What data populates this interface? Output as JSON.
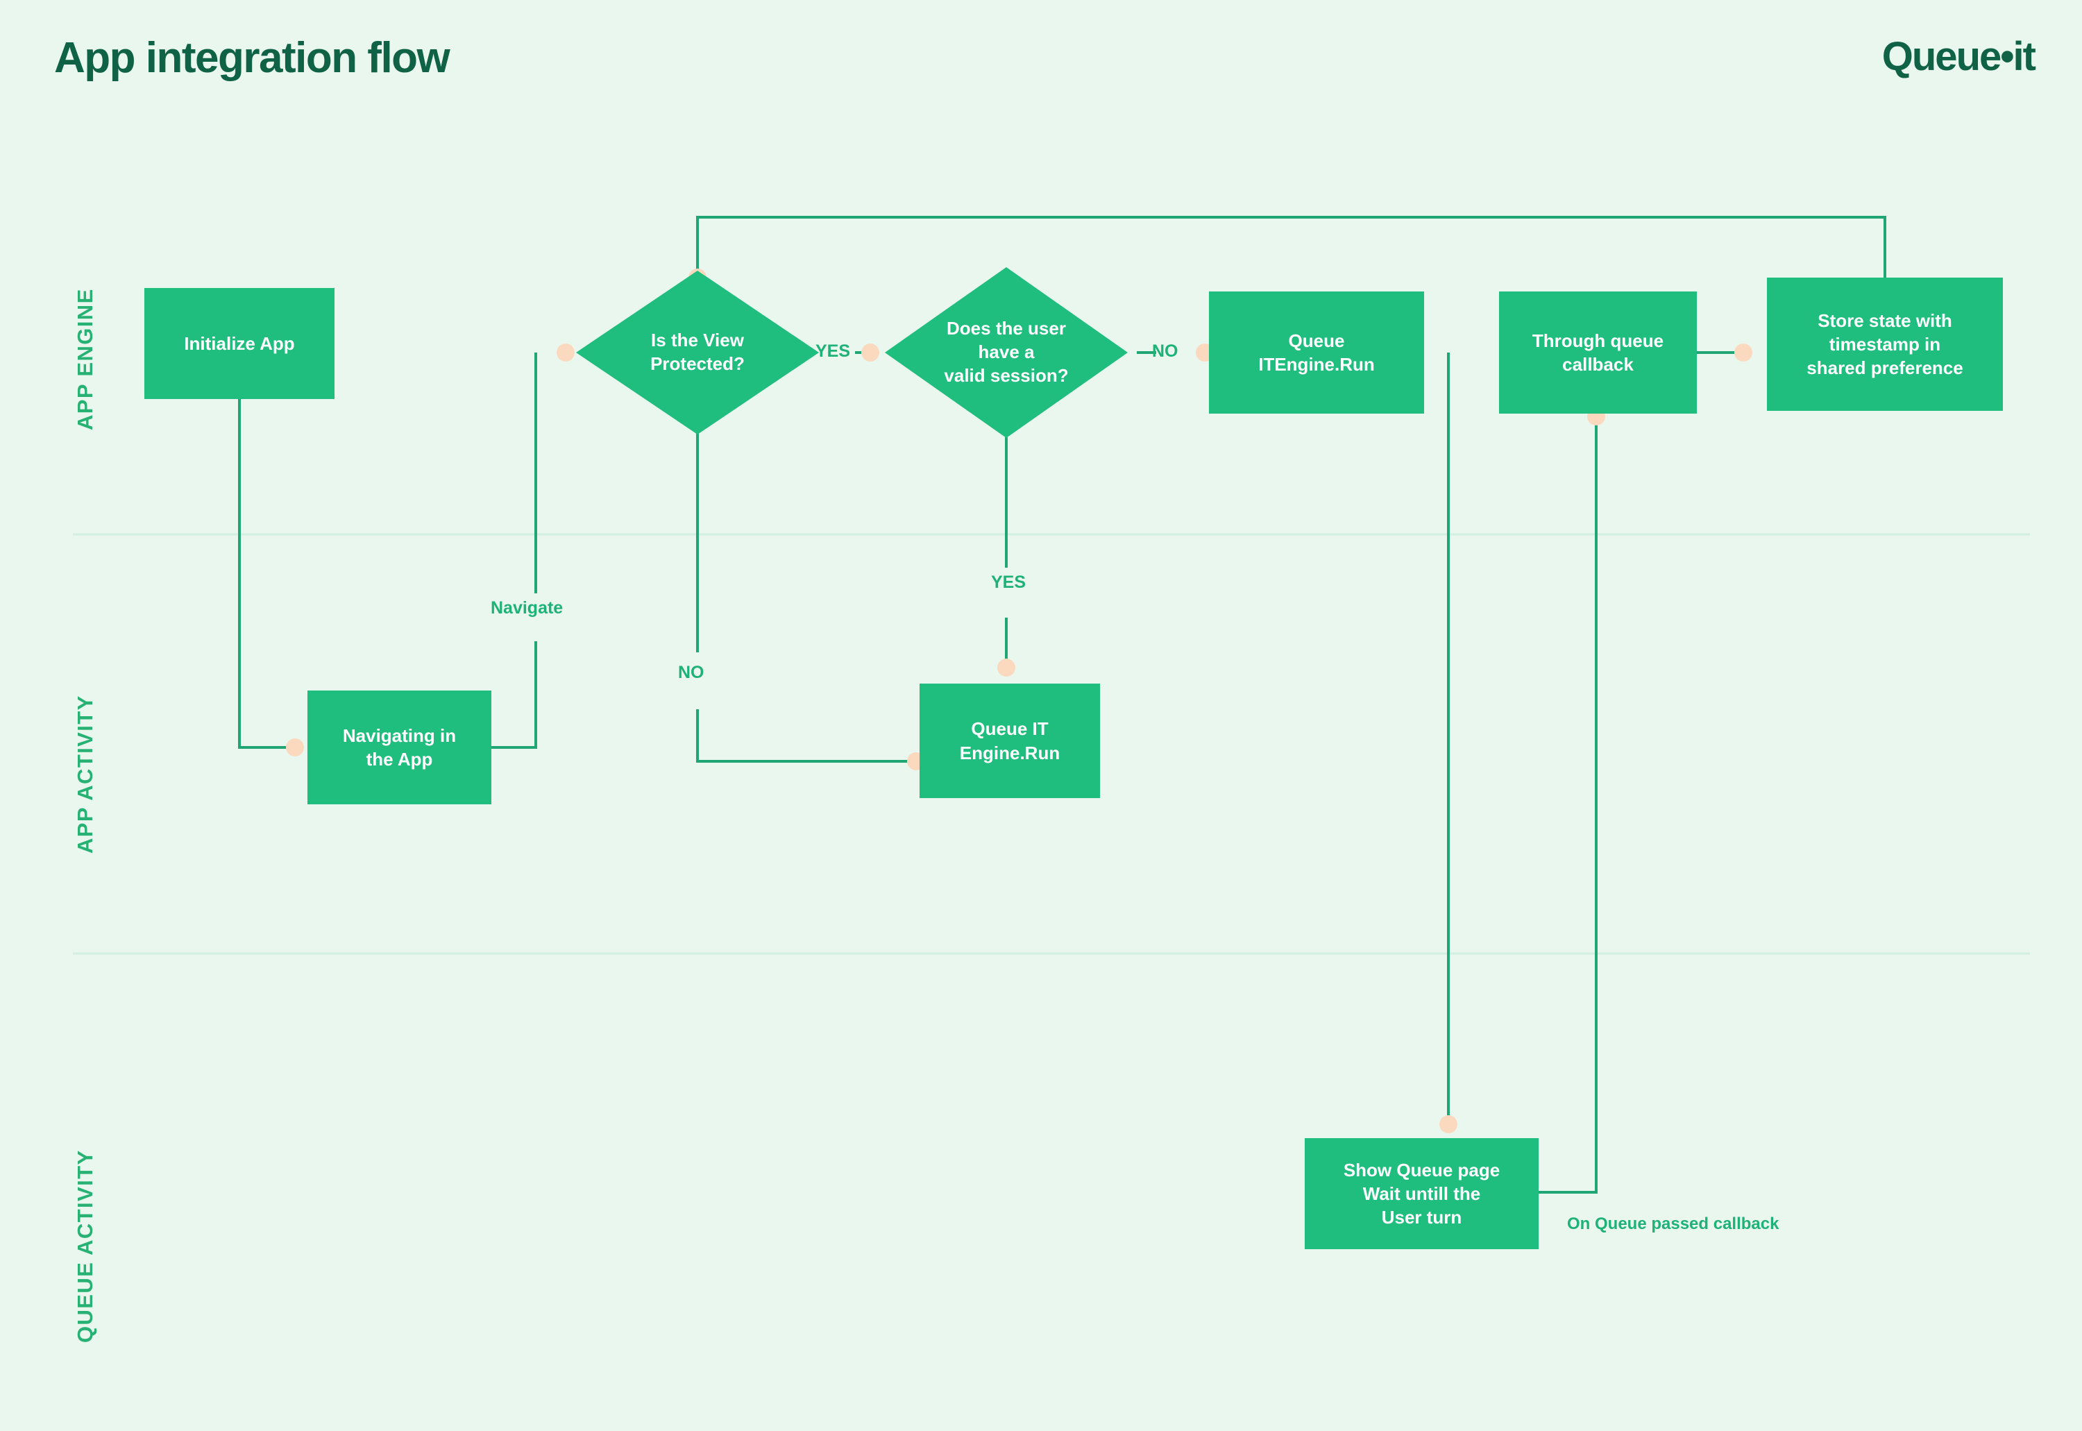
{
  "header": {
    "title": "App integration flow",
    "logo": "Queue•it"
  },
  "colors": {
    "background": "#e9f7ef",
    "node_fill": "#1fbd7e",
    "node_text": "#ffffff",
    "title_green": "#0f6245",
    "accent_green": "#27b274",
    "line_green": "#1fa674",
    "connector_dot": "#fbd9bf",
    "lane_divider": "#d4efe0"
  },
  "lanes": [
    {
      "id": "app-engine",
      "label": "APP ENGINE"
    },
    {
      "id": "app-activity",
      "label": "APP ACTIVITY"
    },
    {
      "id": "queue-activity",
      "label": "QUEUE ACTIVITY"
    }
  ],
  "nodes": {
    "initialize_app": "Initialize App",
    "is_view_protected": "Is the View\nProtected?",
    "valid_session": "Does the  user\nhave a\nvalid session?",
    "queue_itengine_run": "Queue\nITEngine.Run",
    "through_queue_callback": "Through queue\ncallback",
    "store_state": "Store state with\ntimestamp in\nshared preference",
    "navigating_in_app": "Navigating in\nthe App",
    "queue_it_engine_run": "Queue IT\nEngine.Run",
    "show_queue_page": "Show Queue page\nWait untill the\nUser turn"
  },
  "edge_labels": {
    "yes_protected": "YES",
    "no_protected": "NO",
    "yes_session": "YES",
    "no_session": "NO",
    "navigate": "Navigate",
    "on_queue_passed": "On Queue passed callback"
  },
  "chart_data": {
    "type": "diagram",
    "title": "App integration flow",
    "swimlanes": [
      "APP ENGINE",
      "APP ACTIVITY",
      "QUEUE ACTIVITY"
    ],
    "shapes": [
      {
        "id": "initialize_app",
        "lane": "APP ENGINE",
        "type": "process",
        "label": "Initialize App"
      },
      {
        "id": "is_view_protected",
        "lane": "APP ENGINE",
        "type": "decision",
        "label": "Is the View Protected?"
      },
      {
        "id": "valid_session",
        "lane": "APP ENGINE",
        "type": "decision",
        "label": "Does the  user have a valid session?"
      },
      {
        "id": "queue_itengine_run",
        "lane": "APP ENGINE",
        "type": "process",
        "label": "Queue ITEngine.Run"
      },
      {
        "id": "through_queue_callback",
        "lane": "APP ENGINE",
        "type": "process",
        "label": "Through queue callback"
      },
      {
        "id": "store_state",
        "lane": "APP ENGINE",
        "type": "process",
        "label": "Store state with timestamp in shared preference"
      },
      {
        "id": "navigating_in_app",
        "lane": "APP ACTIVITY",
        "type": "process",
        "label": "Navigating in the App"
      },
      {
        "id": "queue_it_engine_run",
        "lane": "APP ACTIVITY",
        "type": "process",
        "label": "Queue IT Engine.Run"
      },
      {
        "id": "show_queue_page",
        "lane": "QUEUE ACTIVITY",
        "type": "process",
        "label": "Show Queue page Wait untill the User turn"
      }
    ],
    "edges": [
      {
        "from": "initialize_app",
        "to": "navigating_in_app",
        "label": ""
      },
      {
        "from": "navigating_in_app",
        "to": "is_view_protected",
        "label": "Navigate"
      },
      {
        "from": "is_view_protected",
        "to": "valid_session",
        "label": "YES"
      },
      {
        "from": "is_view_protected",
        "to": "queue_it_engine_run",
        "label": "NO"
      },
      {
        "from": "valid_session",
        "to": "queue_it_engine_run",
        "label": "YES"
      },
      {
        "from": "valid_session",
        "to": "queue_itengine_run",
        "label": "NO"
      },
      {
        "from": "queue_itengine_run",
        "to": "show_queue_page",
        "label": ""
      },
      {
        "from": "show_queue_page",
        "to": "through_queue_callback",
        "label": "On Queue passed callback"
      },
      {
        "from": "through_queue_callback",
        "to": "store_state",
        "label": ""
      },
      {
        "from": "store_state",
        "to": "is_view_protected",
        "label": ""
      }
    ]
  }
}
